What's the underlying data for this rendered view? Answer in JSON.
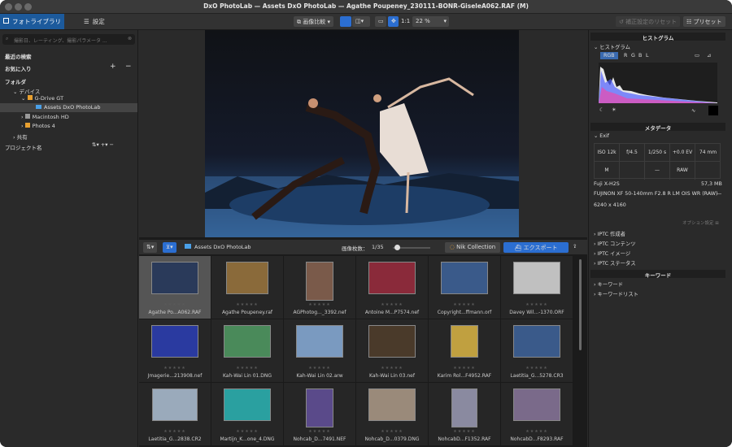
{
  "window": {
    "title": "DxO PhotoLab — Assets DxO PhotoLab — Agathe Poupeney_230111-BONR-GiseleA062.RAF (M)"
  },
  "tabs": {
    "photo_library": "フォトライブラリ",
    "settings": "設定"
  },
  "toolbar": {
    "compare": "画像比較",
    "zoom_ratio": "1:1",
    "zoom_value": "22 %",
    "reset": "補正設定のリセット",
    "presets": "プリセット"
  },
  "sidebar": {
    "search_placeholder": "撮影日、レーティング、撮影パラメータ ...",
    "recent": "最近の検索",
    "favorites": "お気に入り",
    "folders": "フォルダ",
    "devices": "デバイス",
    "gdrive": "G-Drive GT",
    "assets": "Assets DxO PhotoLab",
    "macintosh": "Macintosh HD",
    "photos4": "Photos 4",
    "shared": "共有",
    "project_name": "プロジェクト名"
  },
  "strip": {
    "folder": "Assets DxO PhotoLab",
    "count_label": "画像枚数：",
    "count_value": "1/35",
    "nik": "Nik Collection",
    "export": "エクスポート"
  },
  "thumbnails": [
    {
      "name": "Agathe Po...A062.RAF",
      "color": "#2a3a5a"
    },
    {
      "name": "Agathe Poupeney.raf",
      "color": "#8a6a3a"
    },
    {
      "name": "AGPhotog..._3392.nef",
      "color": "#7a5a4a"
    },
    {
      "name": "Antoine M...P7574.nef",
      "color": "#8a2a3a"
    },
    {
      "name": "Copyright...ffmann.orf",
      "color": "#3a5a8a"
    },
    {
      "name": "Davey Wil...-1370.ORF",
      "color": "#c0c0c0"
    },
    {
      "name": "Jmagerie...213908.nef",
      "color": "#2a3aa0"
    },
    {
      "name": "Kah-Wai Lin 01.DNG",
      "color": "#4a8a5a"
    },
    {
      "name": "Kah-Wai Lin 02.arw",
      "color": "#7a9ac0"
    },
    {
      "name": "Kah-Wai Lin 03.nef",
      "color": "#4a3a2a"
    },
    {
      "name": "Karim Rol...F4952.RAF",
      "color": "#c0a040"
    },
    {
      "name": "Laetitia_G...5278.CR3",
      "color": "#3a5a8a"
    },
    {
      "name": "Laetitia_G...2838.CR2",
      "color": "#9aaabb"
    },
    {
      "name": "Martijn_K...one_4.DNG",
      "color": "#2aa0a0"
    },
    {
      "name": "Nohcab_D...7491.NEF",
      "color": "#5a4a8a"
    },
    {
      "name": "Nohcab_D...0379.DNG",
      "color": "#9a8a7a"
    },
    {
      "name": "NohcabD...F1352.RAF",
      "color": "#8a8aa0"
    },
    {
      "name": "NohcabD...F8293.RAF",
      "color": "#7a6a8a"
    }
  ],
  "right": {
    "histogram": "ヒストグラム",
    "hist_label": "ヒストグラム",
    "channels": [
      "RGB",
      "R",
      "G",
      "B",
      "L"
    ],
    "metadata": "メタデータ",
    "exif": "Exif",
    "exif_values": [
      "ISO 12k",
      "f/4.5",
      "1/250 s",
      "+0.0 EV",
      "74 mm"
    ],
    "exif_row2": [
      "M",
      "",
      "—",
      "RAW",
      ""
    ],
    "camera": "Fuji X-H2S",
    "size": "57,3 MB",
    "lens": "FUJINON XF 50-140mm F2.8 R LM OIS WR (RAW)",
    "lens_extra": "—",
    "dims": "6240 x 4160",
    "options": "オプション設定",
    "iptc": [
      "IPTC 作成者",
      "IPTC コンテンツ",
      "IPTC イメージ",
      "IPTC ステータス"
    ],
    "keywords": "キーワード",
    "kw_items": [
      "キーワード",
      "キーワードリスト"
    ]
  }
}
